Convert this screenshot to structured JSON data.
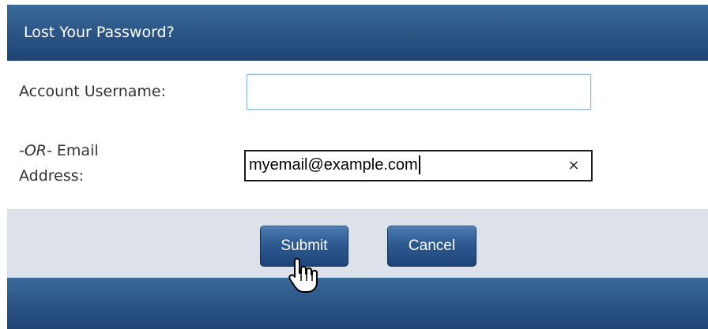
{
  "dialog": {
    "title": "Lost Your Password?"
  },
  "form": {
    "username_label": "Account Username:",
    "username_value": "",
    "email_label_or": "-OR-",
    "email_label_rest": " Email",
    "email_label_line2": "Address:",
    "email_value": "myemail@example.com",
    "clear_icon": "×"
  },
  "buttons": {
    "submit_label": "Submit",
    "cancel_label": "Cancel"
  },
  "colors": {
    "header": "#2a5384",
    "button_bar": "#dde1ea",
    "button": "#2e5a91"
  },
  "icons": {
    "clear": "close-icon",
    "pointer": "hand-pointer-icon"
  }
}
